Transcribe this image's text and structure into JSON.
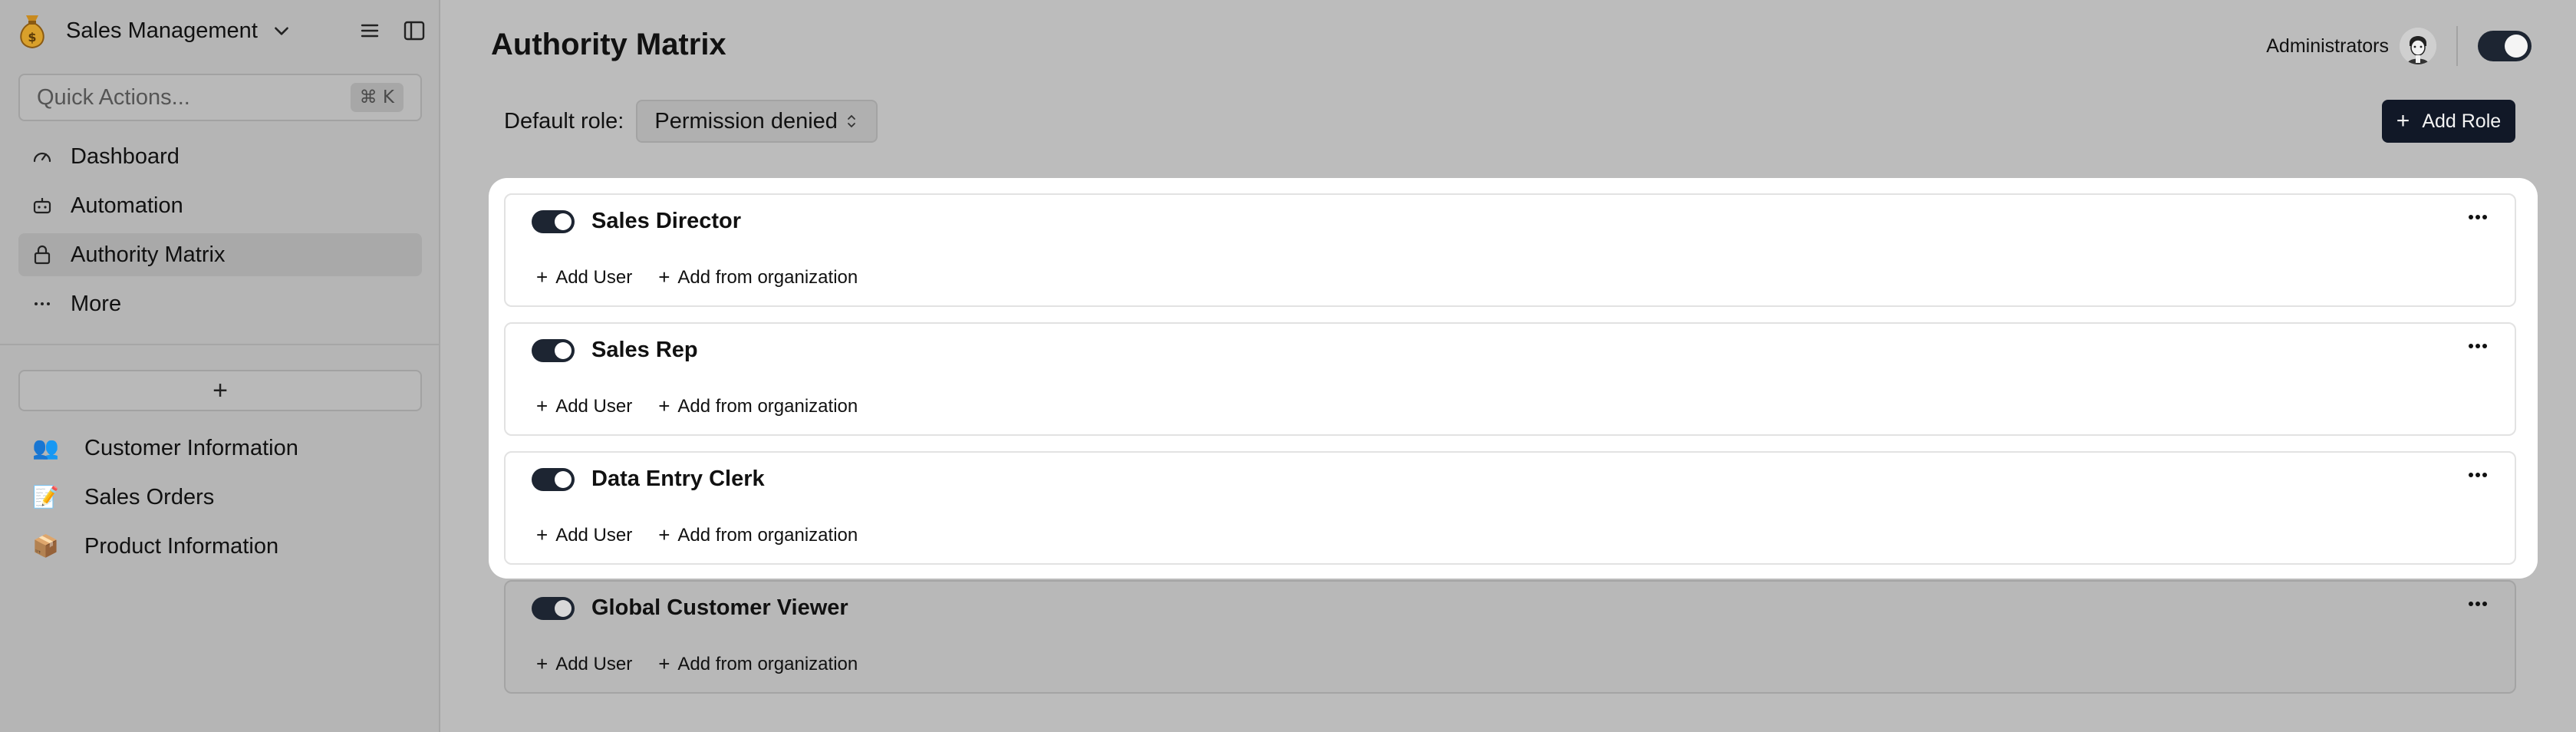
{
  "app": {
    "title": "Sales Management"
  },
  "quick_actions": {
    "placeholder": "Quick Actions...",
    "shortcut": "⌘ K"
  },
  "nav": [
    {
      "label": "Dashboard",
      "icon": "gauge-icon"
    },
    {
      "label": "Automation",
      "icon": "robot-icon"
    },
    {
      "label": "Authority Matrix",
      "icon": "lock-icon",
      "active": true
    },
    {
      "label": "More",
      "icon": "more-icon"
    }
  ],
  "add_table_label": "+",
  "tables": [
    {
      "label": "Customer Information",
      "emoji": "👥"
    },
    {
      "label": "Sales Orders",
      "emoji": "📝"
    },
    {
      "label": "Product Information",
      "emoji": "📦"
    }
  ],
  "page": {
    "title": "Authority Matrix"
  },
  "header": {
    "admins_label": "Administrators"
  },
  "default_role": {
    "label": "Default role:",
    "value": "Permission denied"
  },
  "add_role_label": "Add Role",
  "roles": [
    {
      "name": "Sales Director",
      "enabled": true,
      "add_user": "Add User",
      "add_org": "Add from organization"
    },
    {
      "name": "Sales Rep",
      "enabled": true,
      "add_user": "Add User",
      "add_org": "Add from organization"
    },
    {
      "name": "Data Entry Clerk",
      "enabled": true,
      "add_user": "Add User",
      "add_org": "Add from organization"
    },
    {
      "name": "Global Customer Viewer",
      "enabled": true,
      "add_user": "Add User",
      "add_org": "Add from organization"
    }
  ],
  "colors": {
    "accent_dark": "#111827",
    "toggle_on": "#1d2532",
    "backdrop": "#bcbcbc"
  }
}
